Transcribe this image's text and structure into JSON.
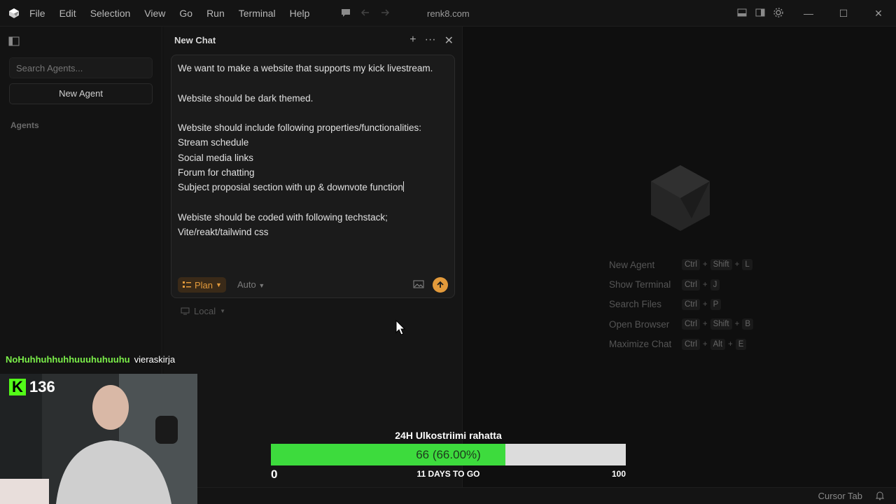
{
  "window": {
    "title": "renk8.com"
  },
  "menu": [
    "File",
    "Edit",
    "Selection",
    "View",
    "Go",
    "Run",
    "Terminal",
    "Help"
  ],
  "sidebar": {
    "search_placeholder": "Search Agents...",
    "new_agent_label": "New Agent",
    "agents_heading": "Agents"
  },
  "chat": {
    "title": "New Chat",
    "message": "We want to make a website that supports my kick livestream.\n\nWebsite should be dark themed.\n\nWebsite should include following properties/functionalities:\nStream schedule\nSocial media links\nForum for chatting\nSubject proposial section with up & downvote function",
    "message_after_caret": "\n\nWebiste should be coded with following techstack;\nVite/reakt/tailwind css",
    "mode_label": "Plan",
    "model_label": "Auto",
    "location_label": "Local"
  },
  "shortcuts": [
    {
      "label": "New Agent",
      "keys": [
        "Ctrl",
        "Shift",
        "L"
      ]
    },
    {
      "label": "Show Terminal",
      "keys": [
        "Ctrl",
        "J"
      ]
    },
    {
      "label": "Search Files",
      "keys": [
        "Ctrl",
        "P"
      ]
    },
    {
      "label": "Open Browser",
      "keys": [
        "Ctrl",
        "Shift",
        "B"
      ]
    },
    {
      "label": "Maximize Chat",
      "keys": [
        "Ctrl",
        "Alt",
        "E"
      ]
    }
  ],
  "statusbar": {
    "right_label": "Cursor Tab"
  },
  "stream_overlay": {
    "chat_user": "NoHuhhuhhuhhuuuhuhuuhu",
    "chat_message": "vieraskirja",
    "viewer_count": "136",
    "goal_title": "24H Ulkostriimi rahatta",
    "goal_value_text": "66 (66.00%)",
    "goal_fraction": 0.66,
    "goal_min": "0",
    "goal_max": "100",
    "goal_days": "11 DAYS TO GO"
  },
  "colors": {
    "accent": "#e39a3b",
    "kick_green": "#53fc18",
    "goal_fill": "#3ddb3d"
  }
}
